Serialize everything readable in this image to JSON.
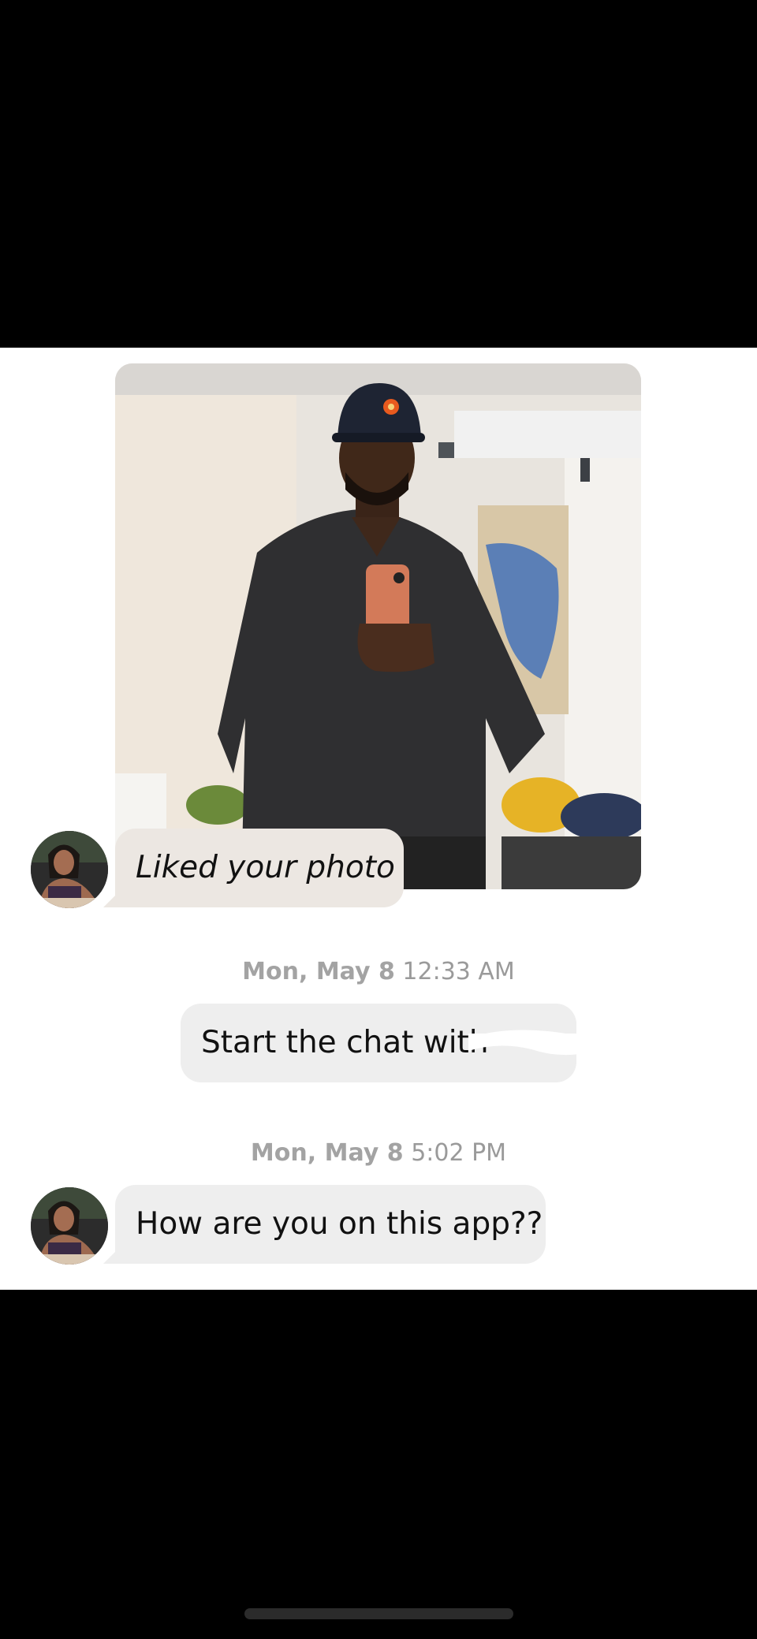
{
  "liked_card": {
    "label": "Liked your photo"
  },
  "messages": [
    {
      "timestamp_day": "Mon, May 8",
      "timestamp_time": "12:33 AM",
      "text": "Start the chat with"
    },
    {
      "timestamp_day": "Mon, May 8",
      "timestamp_time": "5:02 PM",
      "text": "How are you on this app??"
    }
  ],
  "icons": {
    "photo": "photo-image",
    "avatar": "avatar-image"
  },
  "colors": {
    "screen_bg": "#000000",
    "chat_bg": "#ffffff",
    "liked_bubble": "#ece7e2",
    "message_bubble": "#eeeeee",
    "timestamp": "#9a9a9a"
  }
}
